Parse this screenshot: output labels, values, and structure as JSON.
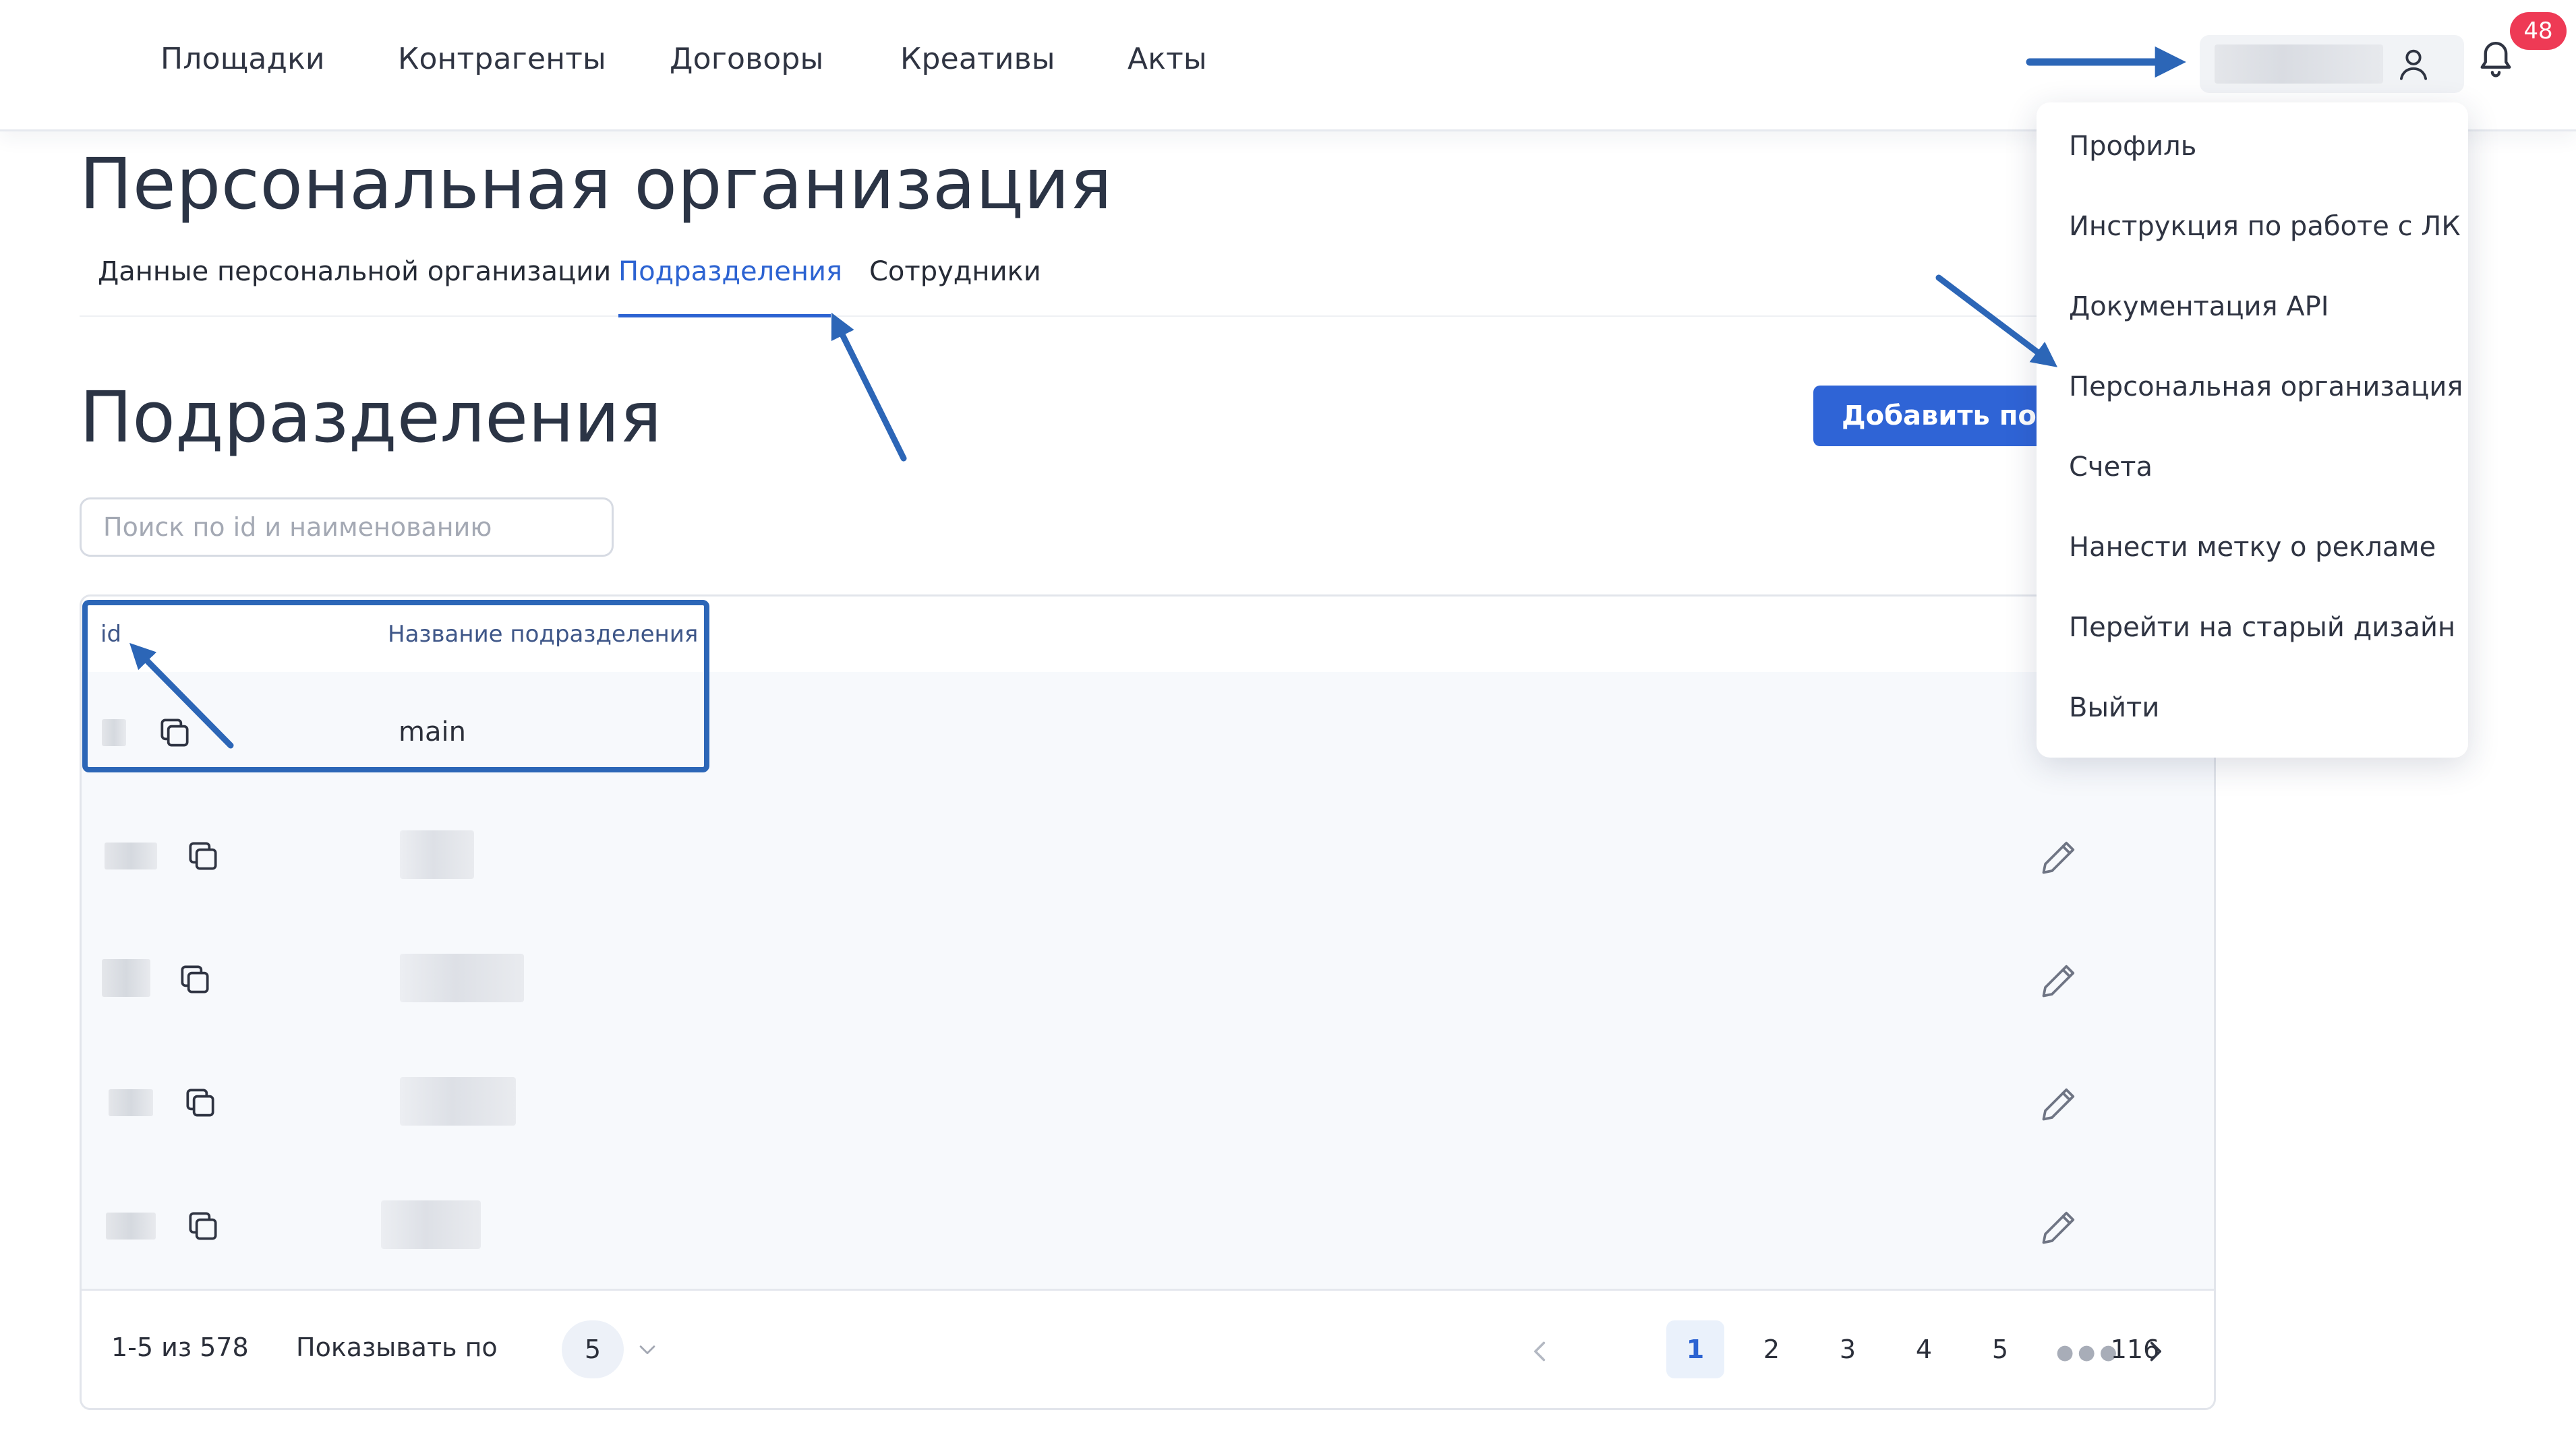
{
  "nav": {
    "items": [
      "Площадки",
      "Контрагенты",
      "Договоры",
      "Креативы",
      "Акты"
    ]
  },
  "header": {
    "notifications_count": "48",
    "icons": {
      "user": "user-icon",
      "notifications": "bell-icon"
    }
  },
  "page": {
    "title": "Персональная организация",
    "tabs": [
      "Данные персональной организации",
      "Подразделения",
      "Сотрудники"
    ],
    "active_tab": "Подразделения"
  },
  "section": {
    "title": "Подразделения",
    "add_button_label": "Добавить подр"
  },
  "search": {
    "placeholder": "Поиск по id и наименованию",
    "value": ""
  },
  "table": {
    "columns": [
      "id",
      "Название подразделения"
    ],
    "rows": [
      {
        "name": "main"
      },
      {
        "name": ""
      },
      {
        "name": ""
      },
      {
        "name": ""
      },
      {
        "name": ""
      }
    ]
  },
  "pagination": {
    "range_text": "1-5 из 578",
    "per_page_label": "Показывать по",
    "per_page_value": "5",
    "pages": [
      "1",
      "2",
      "3",
      "4",
      "5"
    ],
    "last_page": "116",
    "current_page": "1"
  },
  "user_menu": {
    "items": [
      "Профиль",
      "Инструкция по работе с ЛК",
      "Документация API",
      "Персональная организация",
      "Счета",
      "Нанести метку о рекламе",
      "Перейти на старый дизайн",
      "Выйти"
    ]
  },
  "colors": {
    "accent": "#2c63d2",
    "annotation": "#2c66b7",
    "badge": "#ee3a55"
  }
}
